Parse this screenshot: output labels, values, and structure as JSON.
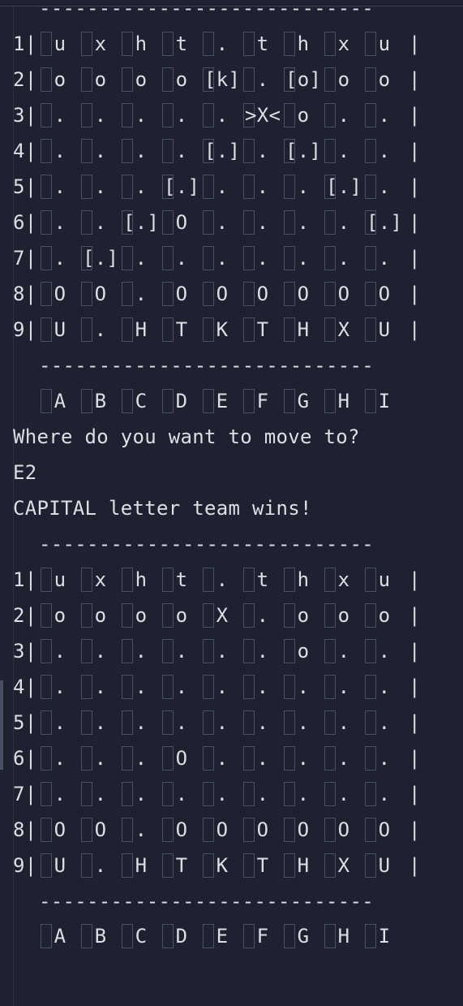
{
  "board1": {
    "rows": [
      {
        "n": "1",
        "cells": [
          "u",
          "x",
          "h",
          "t",
          ".",
          "t",
          "h",
          "x",
          "u"
        ]
      },
      {
        "n": "2",
        "cells": [
          "o",
          "o",
          "o",
          "o",
          "[k]",
          ".",
          "[o]",
          "o",
          "o"
        ]
      },
      {
        "n": "3",
        "cells": [
          ".",
          ".",
          ".",
          ".",
          ".",
          ">X<",
          "o",
          ".",
          "."
        ]
      },
      {
        "n": "4",
        "cells": [
          ".",
          ".",
          ".",
          ".",
          "[.]",
          ".",
          "[.]",
          ".",
          "."
        ]
      },
      {
        "n": "5",
        "cells": [
          ".",
          ".",
          ".",
          "[.]",
          ".",
          ".",
          ".",
          "[.]",
          "."
        ]
      },
      {
        "n": "6",
        "cells": [
          ".",
          ".",
          "[.]",
          "O",
          ".",
          ".",
          ".",
          ".",
          "[.]"
        ]
      },
      {
        "n": "7",
        "cells": [
          ".",
          "[.]",
          ".",
          ".",
          ".",
          ".",
          ".",
          ".",
          "."
        ]
      },
      {
        "n": "8",
        "cells": [
          "O",
          "O",
          ".",
          "O",
          "O",
          "O",
          "O",
          "O",
          "O"
        ]
      },
      {
        "n": "9",
        "cells": [
          "U",
          ".",
          "H",
          "T",
          "K",
          "T",
          "H",
          "X",
          "U"
        ]
      }
    ]
  },
  "separator": "----------------------------",
  "top_separator": "----------------------------",
  "columns": [
    "A",
    "B",
    "C",
    "D",
    "E",
    "F",
    "G",
    "H",
    "I"
  ],
  "prompt": "Where do you want to move to?",
  "input_value": "E2",
  "result": "CAPITAL letter team wins!",
  "board2": {
    "rows": [
      {
        "n": "1",
        "cells": [
          "u",
          "x",
          "h",
          "t",
          ".",
          "t",
          "h",
          "x",
          "u"
        ]
      },
      {
        "n": "2",
        "cells": [
          "o",
          "o",
          "o",
          "o",
          "X",
          ".",
          "o",
          "o",
          "o"
        ]
      },
      {
        "n": "3",
        "cells": [
          ".",
          ".",
          ".",
          ".",
          ".",
          ".",
          "o",
          ".",
          "."
        ]
      },
      {
        "n": "4",
        "cells": [
          ".",
          ".",
          ".",
          ".",
          ".",
          ".",
          ".",
          ".",
          "."
        ]
      },
      {
        "n": "5",
        "cells": [
          ".",
          ".",
          ".",
          ".",
          ".",
          ".",
          ".",
          ".",
          "."
        ]
      },
      {
        "n": "6",
        "cells": [
          ".",
          ".",
          ".",
          "O",
          ".",
          ".",
          ".",
          ".",
          "."
        ]
      },
      {
        "n": "7",
        "cells": [
          ".",
          ".",
          ".",
          ".",
          ".",
          ".",
          ".",
          ".",
          "."
        ]
      },
      {
        "n": "8",
        "cells": [
          "O",
          "O",
          ".",
          "O",
          "O",
          "O",
          "O",
          "O",
          "O"
        ]
      },
      {
        "n": "9",
        "cells": [
          "U",
          ".",
          "H",
          "T",
          "K",
          "T",
          "H",
          "X",
          "U"
        ]
      }
    ]
  }
}
